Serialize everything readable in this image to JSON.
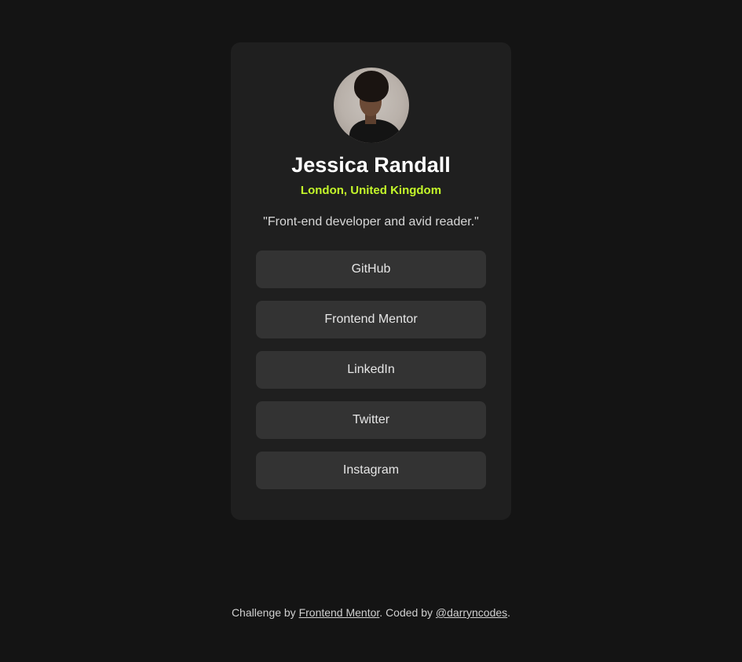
{
  "profile": {
    "name": "Jessica Randall",
    "location": "London, United Kingdom",
    "bio": "\"Front-end developer and avid reader.\""
  },
  "links": [
    {
      "label": "GitHub"
    },
    {
      "label": "Frontend Mentor"
    },
    {
      "label": "LinkedIn"
    },
    {
      "label": "Twitter"
    },
    {
      "label": "Instagram"
    }
  ],
  "footer": {
    "prefix": "Challenge by ",
    "challenge_link": "Frontend Mentor",
    "middle": ". Coded by ",
    "author_link": "@darryncodes",
    "suffix": "."
  },
  "colors": {
    "background": "#141414",
    "card": "#1f1f1f",
    "button": "#333333",
    "accent": "#c4f82a"
  }
}
